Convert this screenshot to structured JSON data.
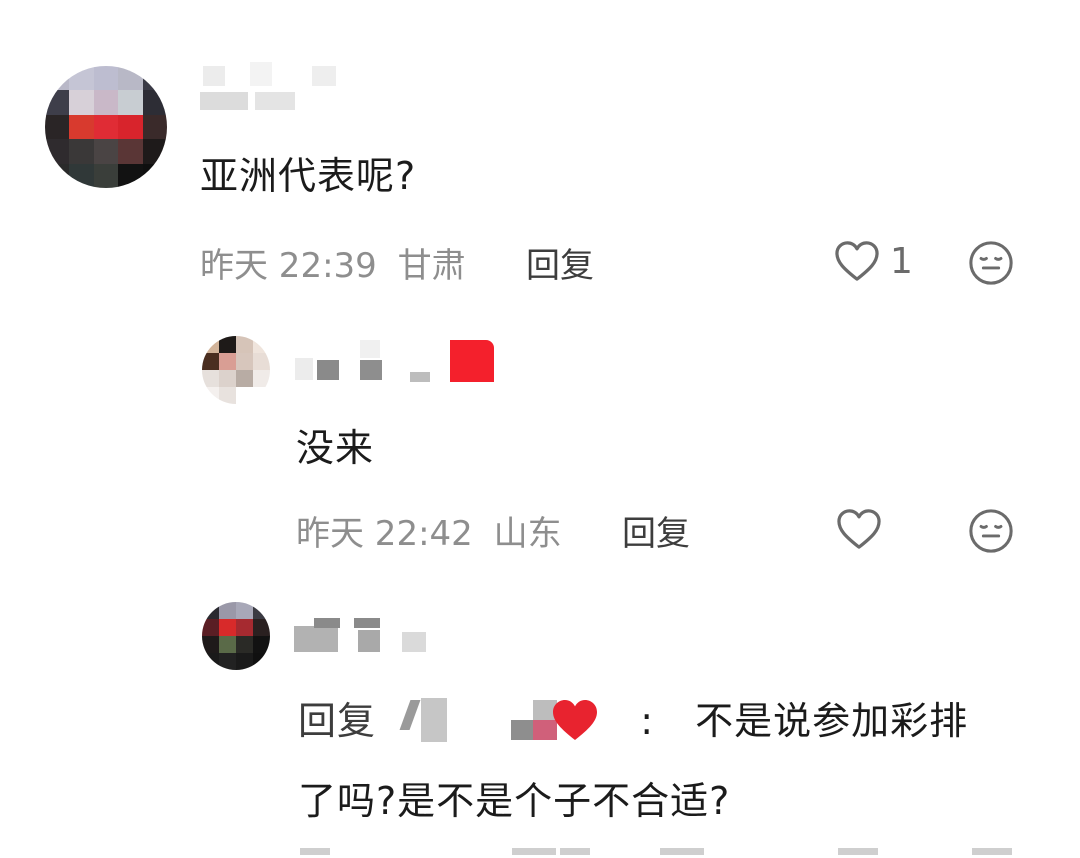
{
  "comments": [
    {
      "text": "亚洲代表呢?",
      "time": "昨天 22:39",
      "location": "甘肃",
      "reply_label": "回复",
      "likes": "1"
    },
    {
      "text": "没来",
      "time": "昨天 22:42",
      "location": "山东",
      "reply_label": "回复",
      "likes": ""
    },
    {
      "reply_prefix": "回复",
      "colon": ":",
      "text_line1": "不是说参加彩排",
      "text_line2": "了吗?是不是个子不合适?"
    }
  ],
  "icons": {
    "like": "heart-outline-icon",
    "emoji": "neutral-face-icon"
  },
  "colors": {
    "meta_gray": "#8e8e8e",
    "heart_red": "#e8232f"
  }
}
